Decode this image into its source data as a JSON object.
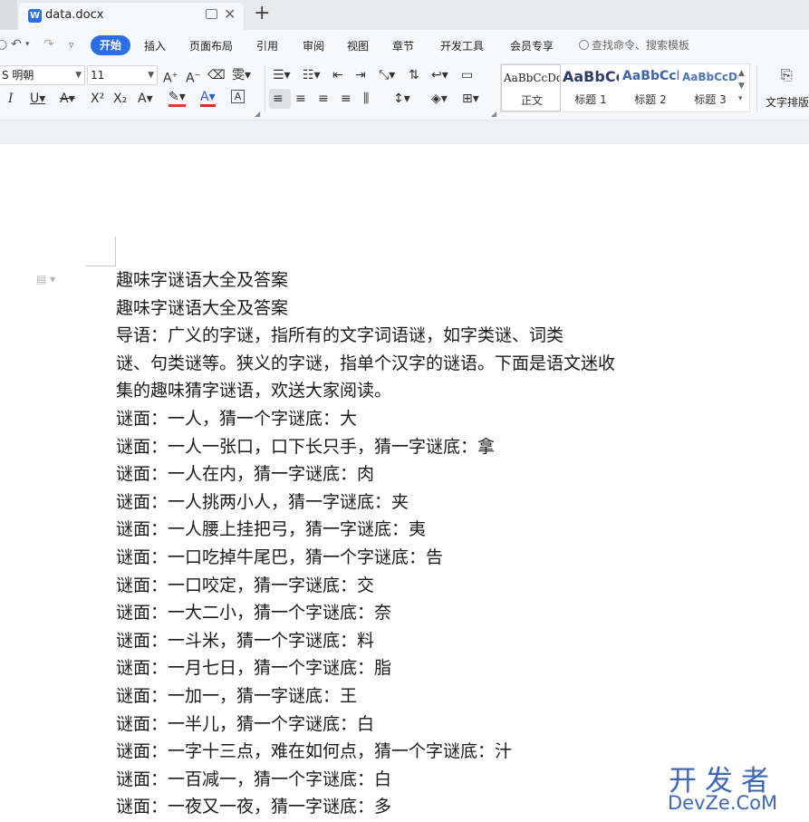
{
  "app": {
    "doc_tab_title": "data.docx",
    "word_icon_letter": "W",
    "accent": "#2b6ee6"
  },
  "menu": {
    "items": [
      "开始",
      "插入",
      "页面布局",
      "引用",
      "审阅",
      "视图",
      "章节",
      "开发工具",
      "会员专享"
    ],
    "active": "开始",
    "search_label": "查找命令、搜索模板"
  },
  "ribbon": {
    "font_name": "S 明朝",
    "font_size": "11",
    "styles": [
      {
        "sample": "AaBbCcDd",
        "name": "正文"
      },
      {
        "sample": "AaBbCc",
        "name": "标题 1"
      },
      {
        "sample": "AaBbCcD",
        "name": "标题 2"
      },
      {
        "sample": "AaBbCcDd",
        "name": "标题 3"
      }
    ],
    "text_layout_label": "文字排版"
  },
  "document": {
    "lines": [
      "趣味字谜语大全及答案",
      "趣味字谜语大全及答案",
      "导语：广义的字谜，指所有的文字词语谜，如字类谜、词类",
      "谜、句类谜等。狭义的字谜，指单个汉字的谜语。下面是语文迷收",
      "集的趣味猜字谜语，欢送大家阅读。",
      "谜面：一人，猜一个字谜底：大",
      "谜面：一人一张口，口下长只手，猜一字谜底：拿",
      "谜面：一人在内，猜一字谜底：肉",
      "谜面：一人挑两小人，猜一字谜底：夹",
      "谜面：一人腰上挂把弓，猜一字谜底：夷",
      "谜面：一口吃掉牛尾巴，猜一个字谜底：告",
      "谜面：一口咬定，猜一字谜底：交",
      "谜面：一大二小，猜一个字谜底：奈",
      "谜面：一斗米，猜一个字谜底：料",
      "谜面：一月七日，猜一个字谜底：脂",
      "谜面：一加一，猜一字谜底：王",
      "谜面：一半儿，猜一个字谜底：白",
      "谜面：一字十三点，难在如何点，猜一个字谜底：汁",
      "谜面：一百减一，猜一个字谜底：白",
      "谜面：一夜又一夜，猜一字谜底：多"
    ]
  },
  "watermark": {
    "line1": "开发者",
    "line2": "DevZe.CoM"
  }
}
